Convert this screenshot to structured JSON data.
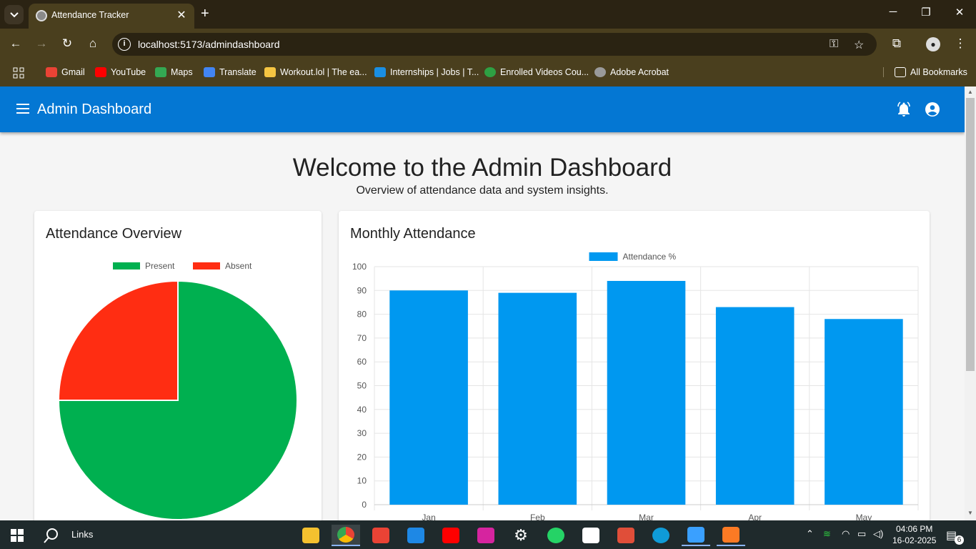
{
  "browser": {
    "tab_title": "Attendance Tracker",
    "url": "localhost:5173/admindashboard",
    "bookmarks": [
      {
        "label": "Gmail",
        "color": "#ea4335"
      },
      {
        "label": "YouTube",
        "color": "#ff0000"
      },
      {
        "label": "Maps",
        "color": "#34a853"
      },
      {
        "label": "Translate",
        "color": "#4285f4"
      },
      {
        "label": "Workout.lol | The ea...",
        "color": "#f5c542"
      },
      {
        "label": "Internships | Jobs | T...",
        "color": "#1a8fe3"
      },
      {
        "label": "Enrolled Videos Cou...",
        "color": "#2ea043"
      },
      {
        "label": "Adobe Acrobat",
        "color": "#9a9a9a"
      }
    ],
    "all_bookmarks": "All Bookmarks"
  },
  "app": {
    "title": "Admin Dashboard",
    "welcome": "Welcome to the Admin Dashboard",
    "subtitle": "Overview of attendance data and system insights.",
    "primary_color": "#0477d3"
  },
  "cards": {
    "overview_title": "Attendance Overview",
    "monthly_title": "Monthly Attendance"
  },
  "chart_data": [
    {
      "type": "pie",
      "legend": [
        "Present",
        "Absent"
      ],
      "legend_placement": "top",
      "labels": [
        "Present",
        "Absent"
      ],
      "values": [
        75,
        25
      ],
      "colors": [
        "#00b050",
        "#ff2d12"
      ]
    },
    {
      "type": "bar",
      "legend": [
        "Attendance %"
      ],
      "legend_placement": "top",
      "categories": [
        "Jan",
        "Feb",
        "Mar",
        "Apr",
        "May"
      ],
      "series": [
        {
          "name": "Attendance %",
          "values": [
            90,
            89,
            94,
            83,
            78
          ]
        }
      ],
      "ylim": [
        0,
        100
      ],
      "yticks": [
        0,
        10,
        20,
        30,
        40,
        50,
        60,
        70,
        80,
        90,
        100
      ],
      "grid": true,
      "color": "#0098f0"
    }
  ],
  "taskbar": {
    "search_label": "Links",
    "time": "04:06 PM",
    "date": "16-02-2025",
    "notifications": "6"
  }
}
